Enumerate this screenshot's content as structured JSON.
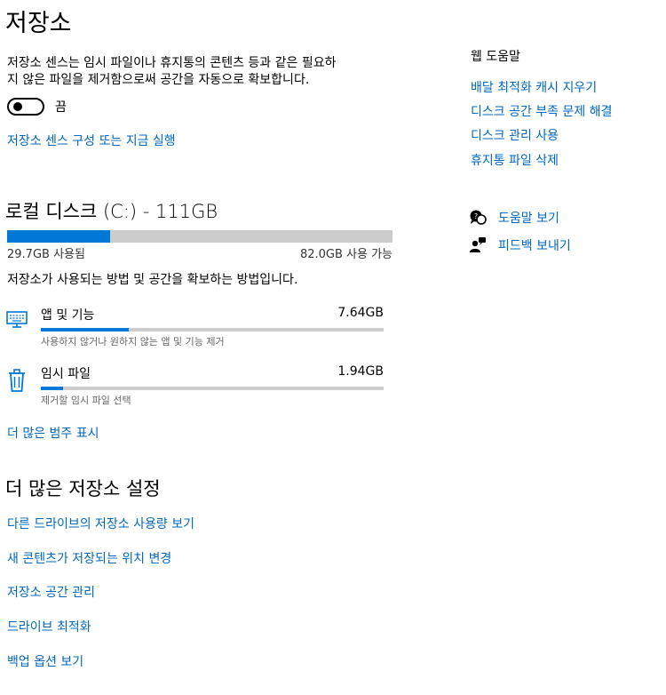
{
  "page_title": "저장소",
  "storage_sense": {
    "description_line1": "저장소 센스는 임시 파일이나 휴지통의 콘텐츠 등과 같은 필요하",
    "description_line2": "지 않은 파일을 제거함으로써 공간을 자동으로 확보합니다.",
    "toggle_state": "끔",
    "configure_link": "저장소 센스 구성 또는 지금 실행"
  },
  "disk": {
    "title": "로컬 디스크 (C:) - 111GB",
    "used_label": "29.7GB 사용됨",
    "free_label": "82.0GB 사용 가능",
    "used_fraction": 0.268,
    "usage_description": "저장소가 사용되는 방법 및 공간을 확보하는 방법입니다."
  },
  "categories": [
    {
      "name": "앱 및 기능",
      "size": "7.64GB",
      "hint": "사용하지 않거나 원하지 않는 앱 및 기능 제거",
      "fill_fraction": 0.257,
      "icon": "monitor-keyboard-icon"
    },
    {
      "name": "임시 파일",
      "size": "1.94GB",
      "hint": "제거할 임시 파일 선택",
      "fill_fraction": 0.065,
      "icon": "trash-icon"
    }
  ],
  "show_more_categories": "더 많은 범주 표시",
  "more_settings": {
    "title": "더 많은 저장소 설정",
    "links": [
      "다른 드라이브의 저장소 사용량 보기",
      "새 콘텐츠가 저장되는 위치 변경",
      "저장소 공간 관리",
      "드라이브 최적화",
      "백업 옵션 보기"
    ]
  },
  "web_help": {
    "title": "웹 도움말",
    "links": [
      "배달 최적화 캐시 지우기",
      "디스크 공간 부족 문제 해결",
      "디스크 관리 사용",
      "휴지통 파일 삭제"
    ]
  },
  "get_help": "도움말 보기",
  "feedback": "피드백 보내기",
  "colors": {
    "accent": "#0078d7",
    "link": "#0067c0",
    "bar_bg": "#cccccc"
  }
}
